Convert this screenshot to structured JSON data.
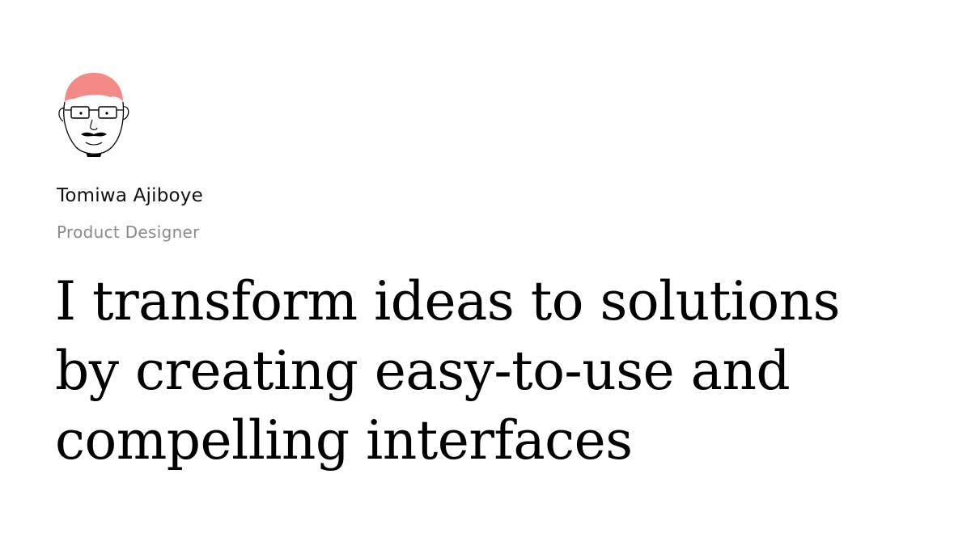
{
  "profile": {
    "name": "Tomiwa Ajiboye",
    "role": "Product Designer",
    "avatar_icon": "portrait-sketch-icon",
    "accent_color": "#f48a86"
  },
  "hero": {
    "lines": [
      "I transform ideas to solutions",
      "by creating easy-to-use and",
      "compelling interfaces"
    ]
  }
}
